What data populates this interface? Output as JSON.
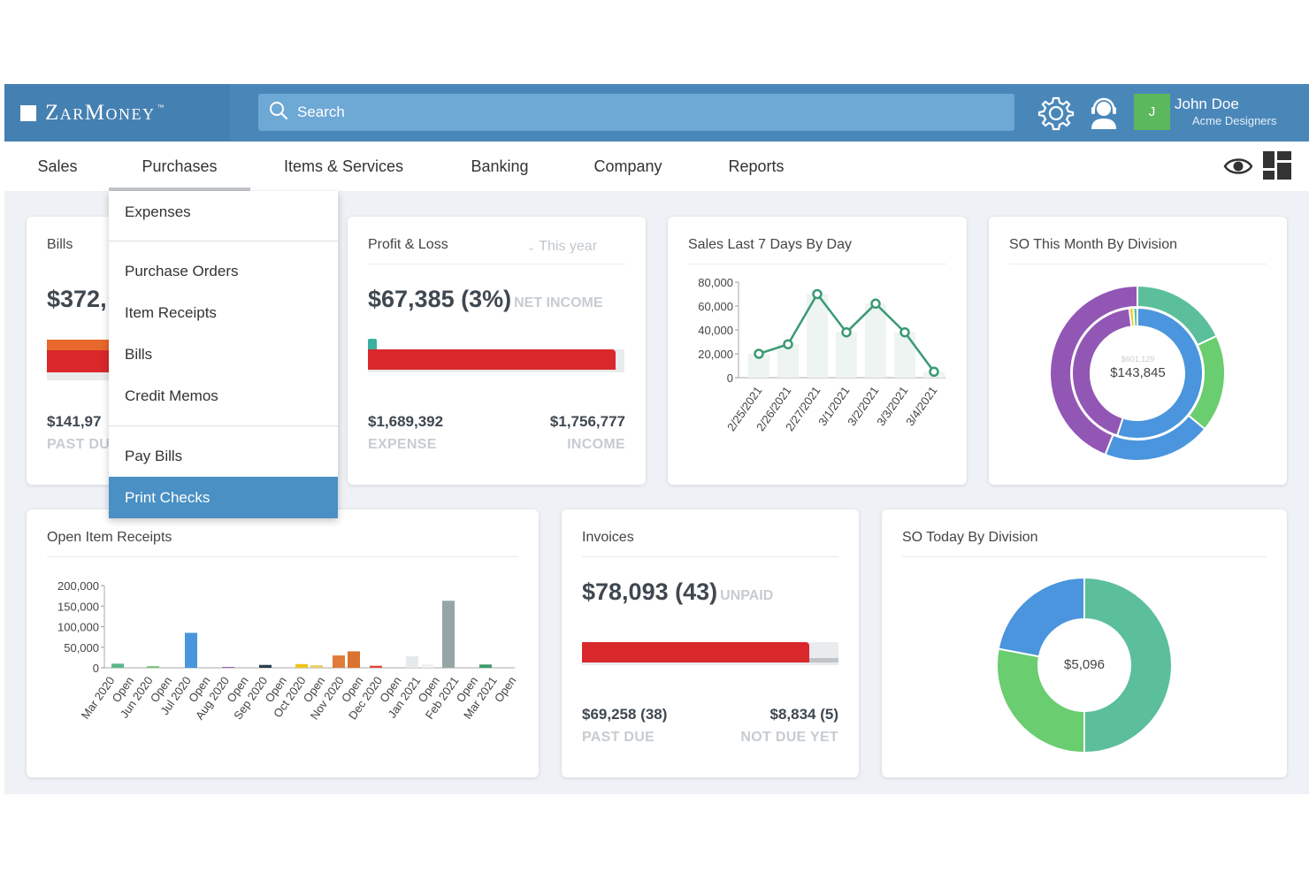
{
  "app": {
    "brand": "ZarMoney",
    "trademark": "™",
    "search_placeholder": "Search",
    "user": {
      "initial": "J",
      "name": "John Doe",
      "company": "Acme Designers"
    },
    "colors": {
      "topbar": "#4a87b9",
      "accent": "#4a90c4",
      "green": "#5cb85c",
      "red": "#d9282c"
    }
  },
  "nav": {
    "items": [
      "Sales",
      "Purchases",
      "Items & Services",
      "Banking",
      "Company",
      "Reports"
    ],
    "active": "Purchases",
    "right_icons": [
      "eye-icon",
      "dashboard-layout-icon"
    ]
  },
  "purchases_menu": {
    "items": [
      "Expenses",
      "Purchase Orders",
      "Item Receipts",
      "Bills",
      "Credit Memos",
      "Pay Bills",
      "Print Checks"
    ],
    "selected": "Print Checks"
  },
  "bills_card": {
    "title": "Bills",
    "total_visible": "$372,",
    "past_due_visible": "$141,97",
    "past_due_label_visible": "PAST DU"
  },
  "profit_loss": {
    "title": "Profit & Loss",
    "period": "This year",
    "net_income": "$67,385 (3%)",
    "net_income_label": "NET INCOME",
    "expense": "$1,689,392",
    "expense_label": "EXPENSE",
    "income": "$1,756,777",
    "income_label": "INCOME"
  },
  "sales_7_days": {
    "title": "Sales Last 7 Days By Day",
    "chart_data": {
      "type": "line",
      "x": [
        "2/25/2021",
        "2/26/2021",
        "2/27/2021",
        "3/1/2021",
        "3/2/2021",
        "3/3/2021",
        "3/4/2021"
      ],
      "values": [
        20000,
        28000,
        70000,
        38000,
        62000,
        38000,
        5000
      ],
      "ylim": [
        0,
        80000
      ],
      "yticks": [
        "80,000",
        "60,000",
        "40,000",
        "20,000",
        "0"
      ],
      "color": "#3a9a72"
    }
  },
  "so_month": {
    "title": "SO This Month By Division",
    "center_sub": "$601,129",
    "center_value": "$143,845",
    "chart_data": {
      "type": "pie",
      "rings": [
        {
          "name": "outer",
          "values": [
            18,
            18,
            20,
            44
          ],
          "colors": [
            "#5bbf9b",
            "#6acd6f",
            "#4a95dd",
            "#9257b5"
          ]
        },
        {
          "name": "inner",
          "values": [
            55,
            43,
            1,
            1
          ],
          "colors": [
            "#4a95dd",
            "#9257b5",
            "#f0c419",
            "#5bbf9b"
          ]
        }
      ]
    }
  },
  "open_receipts": {
    "title": "Open Item Receipts",
    "chart_data": {
      "type": "bar",
      "categories": [
        "Mar 2020",
        "Open",
        "Jun 2020",
        "Open",
        "Jul 2020",
        "Open",
        "Aug 2020",
        "Open",
        "Sep 2020",
        "Open",
        "Oct 2020",
        "Open",
        "Nov 2020",
        "Open",
        "Dec 2020",
        "Open",
        "Jan 2021",
        "Open",
        "Feb 2021",
        "Open",
        "Mar 2021",
        "Open"
      ],
      "yticks": [
        "200,000",
        "150,000",
        "100,000",
        "50,000",
        "0"
      ],
      "ylim": [
        0,
        200000
      ],
      "bars": [
        {
          "x": "Mar 2020",
          "value": 10000,
          "color": "#5ab88a"
        },
        {
          "x": "Jun 2020",
          "value": 4000,
          "color": "#74c47a"
        },
        {
          "x": "Jul 2020",
          "value": 85000,
          "color": "#4a95dd"
        },
        {
          "x": "Aug 2020",
          "value": 2000,
          "color": "#9257b5"
        },
        {
          "x": "Sep 2020",
          "value": 7000,
          "color": "#2c3e50"
        },
        {
          "x": "Oct 2020a",
          "value": 9000,
          "color": "#f0c419"
        },
        {
          "x": "Oct 2020b",
          "value": 6000,
          "color": "#e6cf62"
        },
        {
          "x": "Nov 2020a",
          "value": 30000,
          "color": "#e07b39"
        },
        {
          "x": "Nov 2020b",
          "value": 40000,
          "color": "#d9732f"
        },
        {
          "x": "Dec 2020",
          "value": 5000,
          "color": "#e04a3a"
        },
        {
          "x": "Jan 2021a",
          "value": 28000,
          "color": "#e7eaec"
        },
        {
          "x": "Jan 2021b",
          "value": 8000,
          "color": "#eff1f2"
        },
        {
          "x": "Feb 2021",
          "value": 163000,
          "color": "#95a5a6"
        },
        {
          "x": "Mar 2021",
          "value": 8000,
          "color": "#3d9a6a"
        }
      ]
    }
  },
  "invoices": {
    "title": "Invoices",
    "unpaid": "$78,093 (43)",
    "unpaid_label": "UNPAID",
    "past_due": "$69,258 (38)",
    "past_due_label": "PAST DUE",
    "not_due": "$8,834 (5)",
    "not_due_label": "NOT DUE YET"
  },
  "so_today": {
    "title": "SO Today By Division",
    "center_value": "$5,096",
    "chart_data": {
      "type": "pie",
      "values": [
        50,
        28,
        22
      ],
      "colors": [
        "#5bbf9b",
        "#6acd6f",
        "#4a95dd"
      ]
    }
  }
}
